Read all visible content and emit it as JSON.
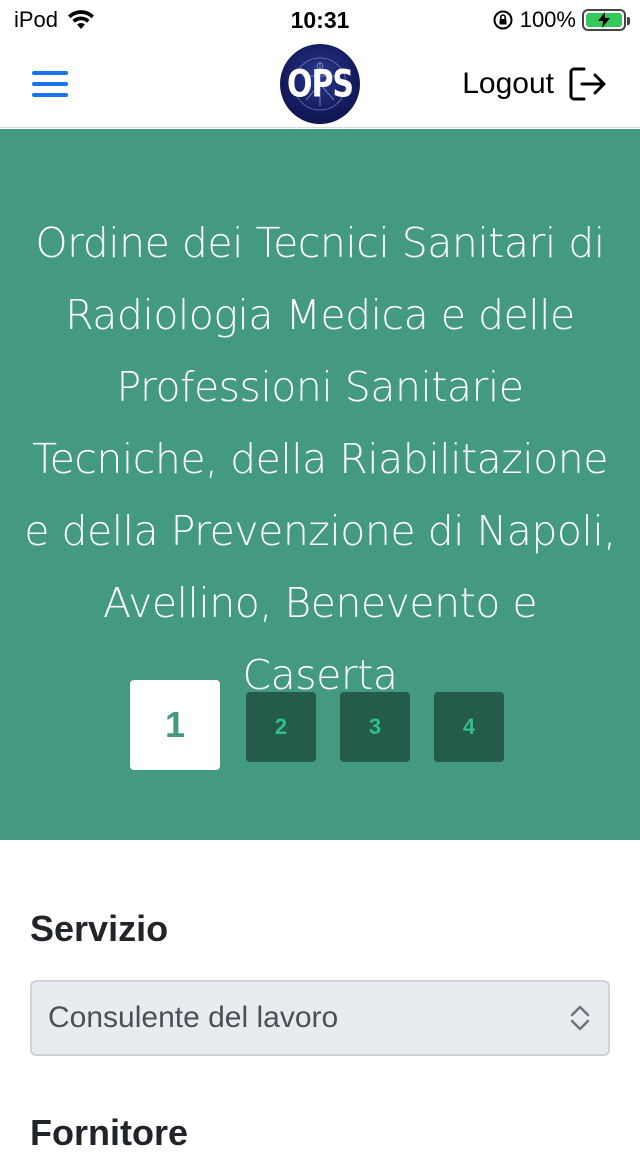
{
  "status_bar": {
    "carrier": "iPod",
    "time": "10:31",
    "battery": "100%"
  },
  "navbar": {
    "logo_text": "OPS",
    "logout_label": "Logout"
  },
  "hero": {
    "title": "Ordine dei Tecnici Sanitari di Radiologia Medica e delle Professioni Sanitarie Tecniche, della Riabilitazione e della Prevenzione di Napoli, Avellino, Benevento e Caserta",
    "steps": [
      {
        "label": "1",
        "active": true
      },
      {
        "label": "2",
        "active": false
      },
      {
        "label": "3",
        "active": false
      },
      {
        "label": "4",
        "active": false
      }
    ]
  },
  "form": {
    "servizio_label": "Servizio",
    "servizio_value": "Consulente del lavoro",
    "fornitore_label": "Fornitore"
  },
  "colors": {
    "hero_bg": "#449a80",
    "step_inactive_bg": "#245b4b",
    "step_inactive_text": "#2fbf87",
    "accent_blue": "#1a73e8"
  }
}
